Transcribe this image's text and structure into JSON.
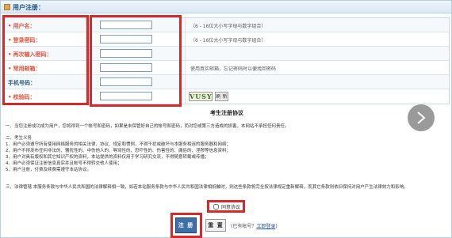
{
  "header": {
    "title": "用户注册："
  },
  "form": {
    "fields": [
      {
        "label": "用户名：",
        "required": true,
        "value": "",
        "hint": "（6 - 16位大小写字母与数字组合）"
      },
      {
        "label": "登录密码：",
        "required": true,
        "value": "",
        "hint": "（6 - 16位大小写字母与数字组合）"
      },
      {
        "label": "再次输入密码：",
        "required": true,
        "value": "",
        "hint": ""
      },
      {
        "label": "常用邮箱：",
        "required": true,
        "value": "",
        "hint": "使用真实邮箱，忘记密码时以便找回密码"
      },
      {
        "label": "手机号码：",
        "required": false,
        "value": "",
        "hint": ""
      },
      {
        "label": "校验码：",
        "required": true,
        "value": "",
        "hint": ""
      }
    ],
    "captcha_text": "VUSY",
    "refresh_label": "刷 新"
  },
  "agreement": {
    "title": "考生注册协议",
    "paragraphs": [
      "一、当您注册成功成为用户，您将得到一个帐号和密码，如果是未保管好自己的帐号和密码，而对您或第三方造成的损害，本网站不承担任何责任。",
      "二、考生义务",
      "1、用户必须遵守所有使用网络服务的相关法律、协议、规定和惯例，不得干扰或破坏与本服务相连的服务器和网络；",
      "2、用户不得发布任何非法的、骚扰性的、中伤他人的、辱骂性的、恐吓性的、伤害性的、庸俗的、淫秽等信息资料；",
      "3、用户对具有版权和其它知识产权的资料，本站提供的资料仅用于学习研究交流，不得随意转载或传播；",
      "4、用户必须保证注册信息真实并且帐号不得转交他人使用；",
      "5、用户注册，付费及续费需遵守本站协议。",
      "三、法律管辖  本服务条款与中华人民共和国的法律解释相一致，如若本站服务条款与中华人民共和国法律相抵触时，则这些条款将完全按法律规定重新解释，而其它条款则依旧保持对用户产生法律效力和影响。"
    ],
    "accept_label": "同意协议"
  },
  "actions": {
    "submit_label": "注 册",
    "reset_label": "重 置",
    "login_prefix": "(已有帐号？",
    "login_link": "立即登录",
    "login_suffix": ")"
  }
}
